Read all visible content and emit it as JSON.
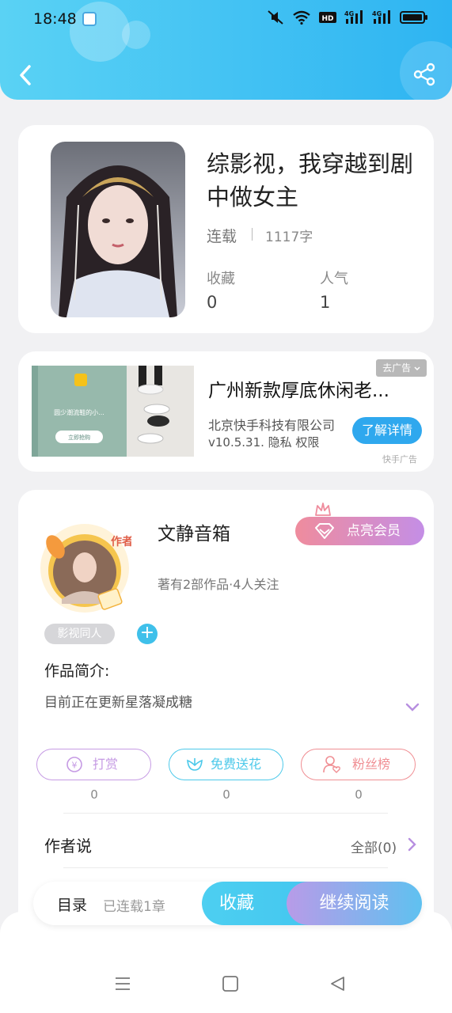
{
  "status_bar": {
    "time": "18:48"
  },
  "book": {
    "title": "综影视，我穿越到剧中做女主",
    "status": "连载",
    "word_count": "1117字",
    "stats": [
      {
        "label": "收藏",
        "value": "0"
      },
      {
        "label": "人气",
        "value": "1"
      }
    ]
  },
  "ad": {
    "close_label": "去广告",
    "title": "广州新款厚底休闲老...",
    "company": "北京快手科技有限公司",
    "meta": "v10.5.31.  隐私  权限",
    "button": "了解详情",
    "source": "快手广告",
    "image_text": "圆少潮流鞋的小...",
    "image_button": "立即抢购"
  },
  "author": {
    "badge": "作者",
    "name": "文静音箱",
    "meta": "著有2部作品·4人关注",
    "vip_button": "点亮会员",
    "tag": "影视同人",
    "tag_add": "+",
    "intro_label": "作品简介:",
    "intro_text": "目前正在更新星落凝成糖",
    "actions": [
      {
        "label": "打赏",
        "count": "0",
        "color": "#c69be4"
      },
      {
        "label": "免费送花",
        "count": "0",
        "color": "#4cc9ea"
      },
      {
        "label": "粉丝榜",
        "count": "0",
        "color": "#f08f94"
      }
    ],
    "says_label": "作者说",
    "says_all": "全部(0)"
  },
  "bottom_bar": {
    "toc_label": "目录",
    "toc_status": "已连载1章",
    "fav_button": "收藏",
    "read_button": "继续阅读"
  }
}
